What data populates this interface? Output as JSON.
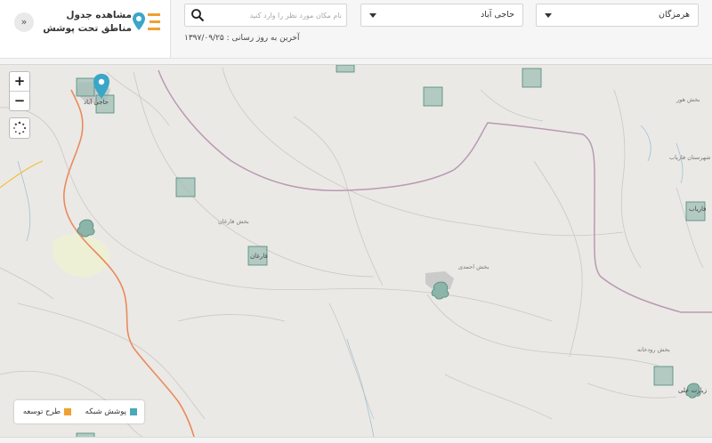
{
  "panel": {
    "title_line1": "مشاهده جدول",
    "title_line2": "مناطق تحت پوشش",
    "collapse_icon": "double-chevron-down-icon",
    "icon": "map-pin-list-icon"
  },
  "search": {
    "placeholder": "نام مکان مورد نظر را وارد کنید",
    "value": "",
    "icon": "search-icon"
  },
  "province_select": {
    "value": "هرمزگان"
  },
  "city_select": {
    "value": "حاجی آباد"
  },
  "last_update": {
    "text": "آخرین به روز رسانی : ۱۳۹۷/۰۹/۲۵"
  },
  "map_controls": {
    "zoom_in": "+",
    "zoom_out": "−",
    "locate_icon": "locate-spinner-icon"
  },
  "map_labels": {
    "haji_abad": "حاجی آباد",
    "bakhsh_farghan": "بخش فارغان",
    "farghan": "فارغان",
    "bakhsh_ahmadi": "بخش احمدی",
    "fariyab": "فاریاب",
    "shahrestan_fariyab": "شهرستان فاریاب",
    "bakhsh_hoor": "بخش هور",
    "bakhsh_roudkhaneh": "بخش رودخانه",
    "zirat_ali": "زیارت علی"
  },
  "legend": {
    "network_coverage": "پوشش شبکه",
    "development_plan": "طرح توسعه",
    "network_color": "#4aa8b8",
    "development_color": "#f0a030"
  },
  "colors": {
    "accent": "#f0a030",
    "pin": "#3aa6c8",
    "coverage_fill": "#9fbfb5",
    "coverage_stroke": "#4c8a7a",
    "road": "#e98a5e",
    "boundary": "#b89ab4"
  }
}
